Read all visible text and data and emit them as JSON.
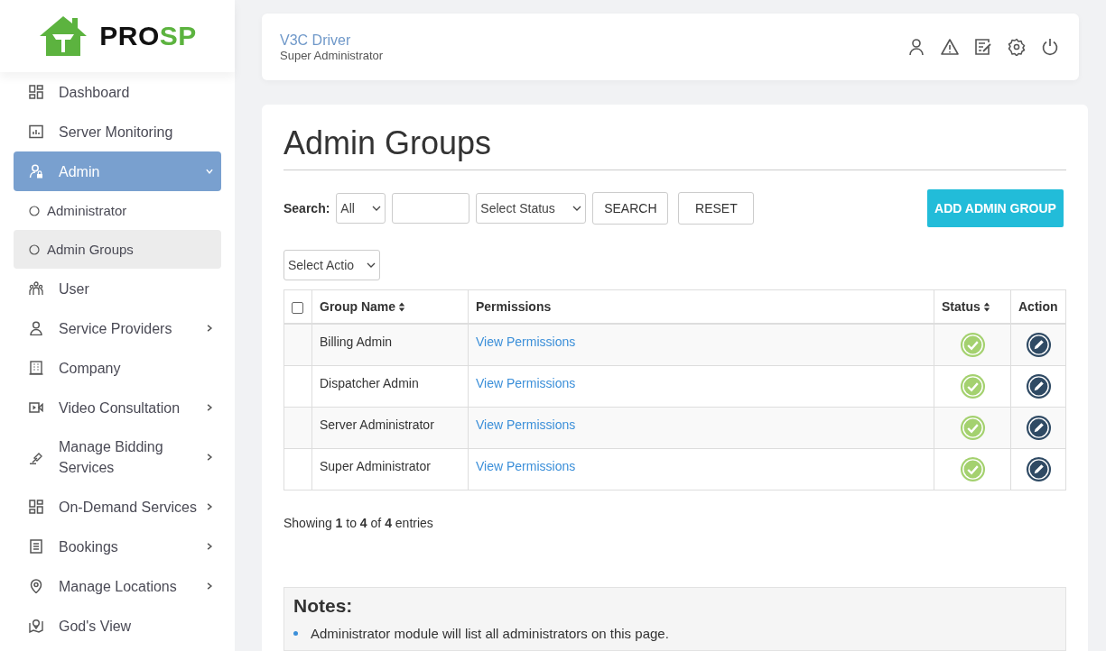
{
  "brand": {
    "name_dark": "PRO",
    "name_accent": "SP"
  },
  "sidebar": {
    "items": [
      {
        "label": "Dashboard",
        "kind": "grid",
        "selected": false,
        "expandable": false
      },
      {
        "label": "Server Monitoring",
        "kind": "chart",
        "selected": false,
        "expandable": false
      },
      {
        "label": "Admin",
        "kind": "admin",
        "selected": true,
        "expandable": true,
        "expanded": true,
        "children": [
          {
            "label": "Administrator",
            "selected": false
          },
          {
            "label": "Admin Groups",
            "selected": true
          }
        ]
      },
      {
        "label": "User",
        "kind": "users",
        "selected": false,
        "expandable": false
      },
      {
        "label": "Service Providers",
        "kind": "person",
        "selected": false,
        "expandable": true,
        "expanded": false
      },
      {
        "label": "Company",
        "kind": "building",
        "selected": false,
        "expandable": false
      },
      {
        "label": "Video Consultation",
        "kind": "video",
        "selected": false,
        "expandable": true,
        "expanded": false
      },
      {
        "label": "Manage Bidding Services",
        "kind": "gavel",
        "selected": false,
        "expandable": true,
        "expanded": false
      },
      {
        "label": "On-Demand Services",
        "kind": "grid",
        "selected": false,
        "expandable": true,
        "expanded": false
      },
      {
        "label": "Bookings",
        "kind": "list",
        "selected": false,
        "expandable": true,
        "expanded": false
      },
      {
        "label": "Manage Locations",
        "kind": "pin",
        "selected": false,
        "expandable": true,
        "expanded": false
      },
      {
        "label": "God's View",
        "kind": "map",
        "selected": false,
        "expandable": false
      }
    ]
  },
  "header": {
    "user_name": "V3C Driver",
    "role": "Super Administrator"
  },
  "page": {
    "title": "Admin Groups",
    "search": {
      "label": "Search:",
      "field_select": "All",
      "status_select": "Select Status",
      "search_button": "SEARCH",
      "reset_button": "RESET"
    },
    "add_button": "ADD ADMIN GROUP",
    "action_select": "Select Actio",
    "table": {
      "select_all_checked": false,
      "columns": [
        "Group Name",
        "Permissions",
        "Status",
        "Action"
      ],
      "rows": [
        {
          "group_name": "Billing Admin",
          "permissions": "View Permissions",
          "active": true
        },
        {
          "group_name": "Dispatcher Admin",
          "permissions": "View Permissions",
          "active": true
        },
        {
          "group_name": "Server Administrator",
          "permissions": "View Permissions",
          "active": true
        },
        {
          "group_name": "Super Administrator",
          "permissions": "View Permissions",
          "active": true
        }
      ]
    },
    "summary": "Showing **1** to **4** of **4** entries",
    "notes": {
      "title": "Notes:",
      "items": [
        "Administrator module will list all administrators on this page."
      ]
    }
  }
}
